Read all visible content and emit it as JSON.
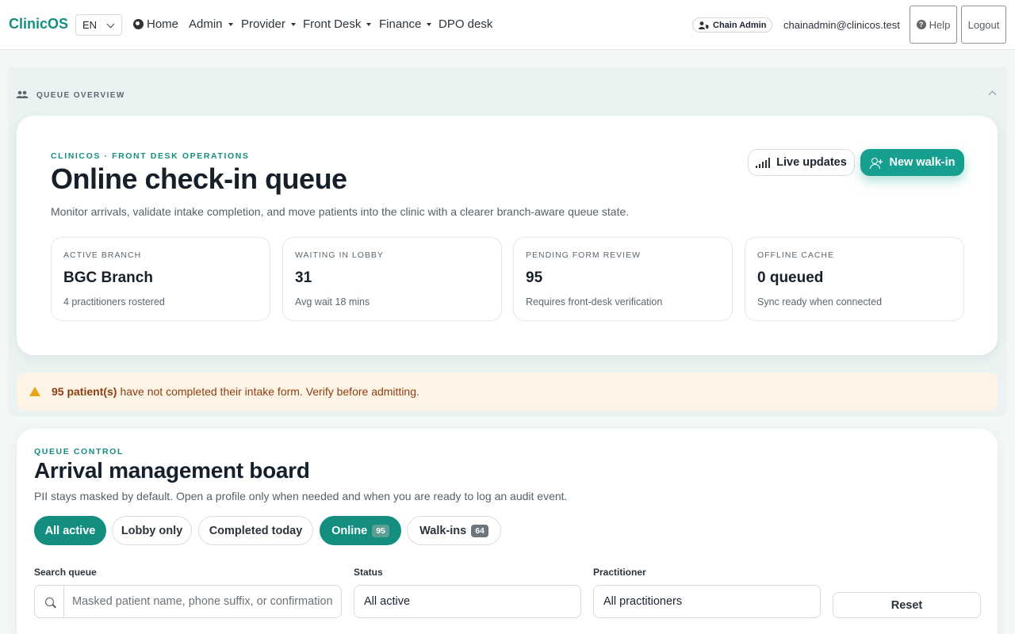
{
  "nav": {
    "brand": "ClinicOS",
    "language": "EN",
    "items": [
      {
        "label": "Home"
      },
      {
        "label": "Admin"
      },
      {
        "label": "Provider"
      },
      {
        "label": "Front Desk"
      },
      {
        "label": "Finance"
      },
      {
        "label": "DPO desk"
      }
    ],
    "role_badge": "Chain Admin",
    "user_email": "chainadmin@clinicos.test",
    "help_label": "Help",
    "logout_label": "Logout"
  },
  "overview": {
    "section_label": "QUEUE OVERVIEW",
    "eyebrow": "CLINICOS · FRONT DESK OPERATIONS",
    "title": "Online check-in queue",
    "subtitle": "Monitor arrivals, validate intake completion, and move patients into the clinic with a clearer branch-aware queue state.",
    "live_updates_label": "Live updates",
    "new_walkin_label": "New walk-in",
    "stats": [
      {
        "label": "ACTIVE BRANCH",
        "value": "BGC Branch",
        "note": "4 practitioners rostered"
      },
      {
        "label": "WAITING IN LOBBY",
        "value": "31",
        "note": "Avg wait 18 mins"
      },
      {
        "label": "PENDING FORM REVIEW",
        "value": "95",
        "note": "Requires front-desk verification"
      },
      {
        "label": "OFFLINE CACHE",
        "value": "0 queued",
        "note": "Sync ready when connected"
      }
    ]
  },
  "alert": {
    "bold": "95 patient(s)",
    "text": "have not completed their intake form. Verify before admitting."
  },
  "board": {
    "eyebrow": "QUEUE CONTROL",
    "title": "Arrival management board",
    "subtitle": "PII stays masked by default. Open a profile only when needed and when you are ready to log an audit event.",
    "chips": [
      {
        "label": "All active",
        "count": null
      },
      {
        "label": "Lobby only",
        "count": null
      },
      {
        "label": "Completed today",
        "count": null
      },
      {
        "label": "Online",
        "count": "95"
      },
      {
        "label": "Walk-ins",
        "count": "64"
      }
    ],
    "filters": {
      "search_label": "Search queue",
      "search_placeholder": "Masked patient name, phone suffix, or confirmation",
      "status_label": "Status",
      "status_value": "All active",
      "practitioner_label": "Practitioner",
      "practitioner_value": "All practitioners",
      "reset_label": "Reset"
    }
  },
  "colors": {
    "brand": "#148f7f",
    "accent_button": "#17a08f",
    "alert_bg": "#fdf4e5",
    "alert_text": "#8b3e12",
    "warning_icon": "#e8a419"
  },
  "icons": {
    "home": "globe-icon",
    "role": "user-shield-icon",
    "help": "question-circle-icon",
    "section": "users-icon",
    "live": "signal-bars-icon",
    "walkin": "user-plus-icon",
    "alert": "warning-triangle-icon",
    "search": "search-icon"
  }
}
